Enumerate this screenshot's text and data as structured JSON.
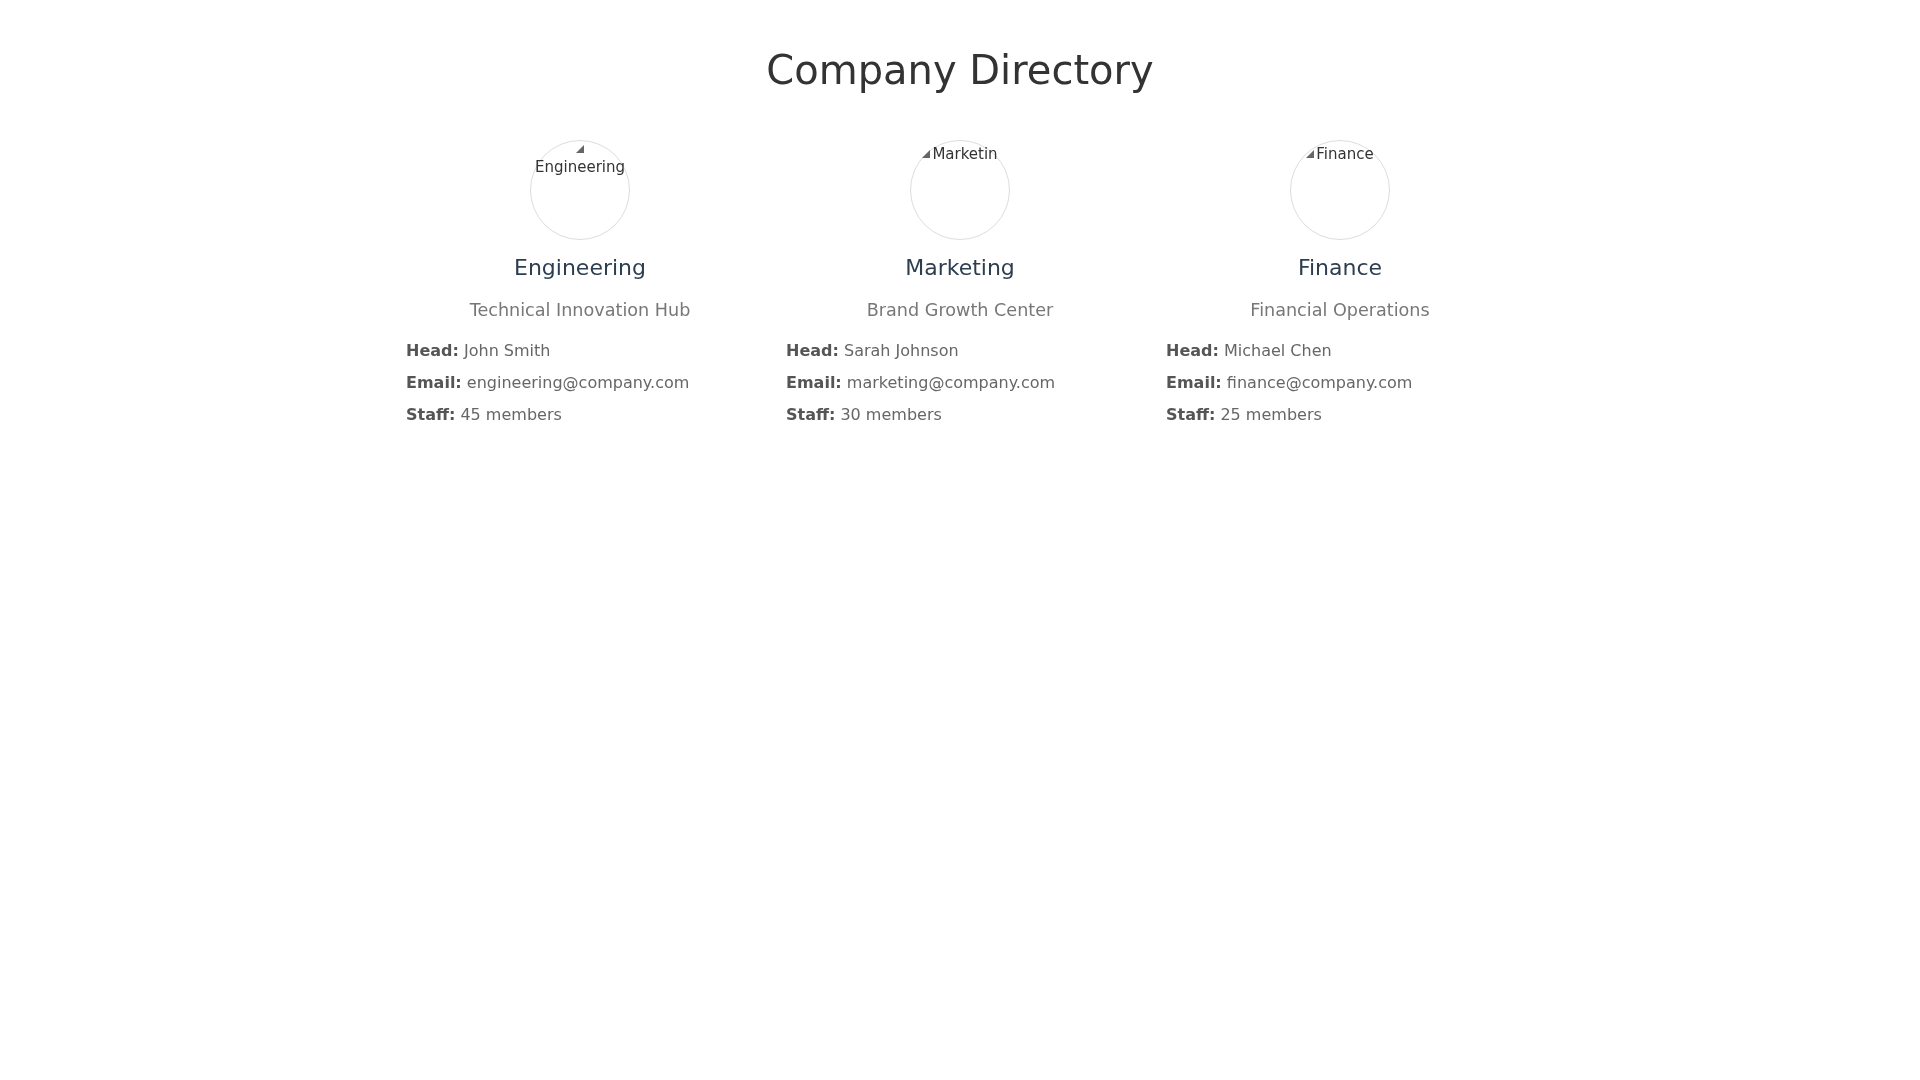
{
  "page": {
    "title": "Company Directory"
  },
  "departments": [
    {
      "image": {
        "alt_text": "Engineering"
      },
      "name": "Engineering",
      "tagline": "Technical Innovation Hub",
      "details": [
        "**Head:** John Smith",
        "**Email:** engineering@company.com",
        "**Staff:** 45 members"
      ]
    },
    {
      "image": {
        "alt_text": "Marketin"
      },
      "name": "Marketing",
      "tagline": "Brand Growth Center",
      "details": [
        "**Head:** Sarah Johnson",
        "**Email:** marketing@company.com",
        "**Staff:** 30 members"
      ]
    },
    {
      "image": {
        "alt_text": "Finance"
      },
      "name": "Finance",
      "tagline": "Financial Operations",
      "details": [
        "**Head:** Michael Chen",
        "**Email:** finance@company.com",
        "**Staff:** 25 members"
      ]
    }
  ]
}
